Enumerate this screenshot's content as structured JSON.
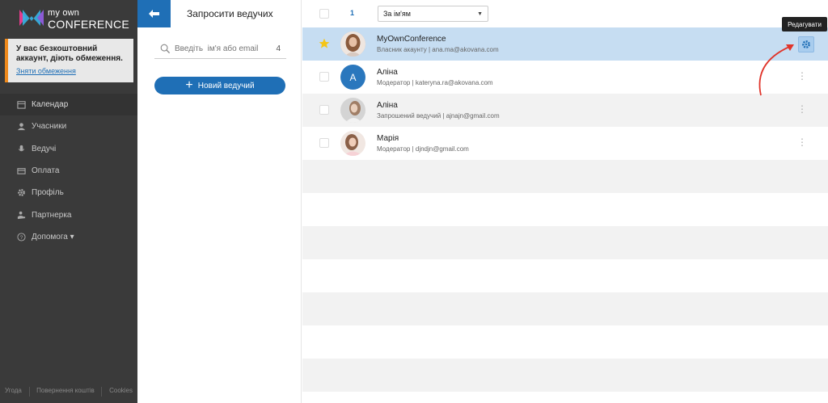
{
  "app": {
    "logo_line1": "my own",
    "logo_line2": "CONFERENCE"
  },
  "notice": {
    "text": "У вас безкоштовний аккаунт, діють обмеження.",
    "link": "Зняти обмеження",
    "accent": "#f08a1c"
  },
  "nav": [
    {
      "label": "Календар",
      "icon": "calendar-icon"
    },
    {
      "label": "Учасники",
      "icon": "users-icon"
    },
    {
      "label": "Ведучі",
      "icon": "microphone-icon"
    },
    {
      "label": "Оплата",
      "icon": "card-icon"
    },
    {
      "label": "Профіль",
      "icon": "gear-icon"
    },
    {
      "label": "Партнерка",
      "icon": "handshake-icon"
    },
    {
      "label": "Допомога ▾",
      "icon": "help-icon"
    }
  ],
  "footer": [
    "Угода",
    "Повернення коштів",
    "Cookies"
  ],
  "panel": {
    "title": "Запросити ведучих",
    "search_placeholder": "Введіть  ім'я або email",
    "count": "4",
    "new_button": "Новий ведучий"
  },
  "toolbar": {
    "selected_count": "1",
    "sort_value": "За ім'ям"
  },
  "hosts": [
    {
      "name": "MyOwnConference",
      "role": "Власник акаунту",
      "email": "ana.ma@akovana.com",
      "avatar": "photo",
      "owner": true
    },
    {
      "name": "Аліна",
      "role": "Модератор",
      "email": "kateryna.ra@akovana.com",
      "avatar": "A"
    },
    {
      "name": "Аліна",
      "role": "Запрошений ведучий",
      "email": "ajnajn@gmail.com",
      "avatar": "photo"
    },
    {
      "name": "Марія",
      "role": "Модератор",
      "email": "djndjn@gmail.com",
      "avatar": "photo"
    }
  ],
  "tooltip": "Редагувати",
  "colors": {
    "brand": "#1f6fb6",
    "sidebar": "#3a3a3a",
    "selected_row": "#c6ddf2"
  }
}
